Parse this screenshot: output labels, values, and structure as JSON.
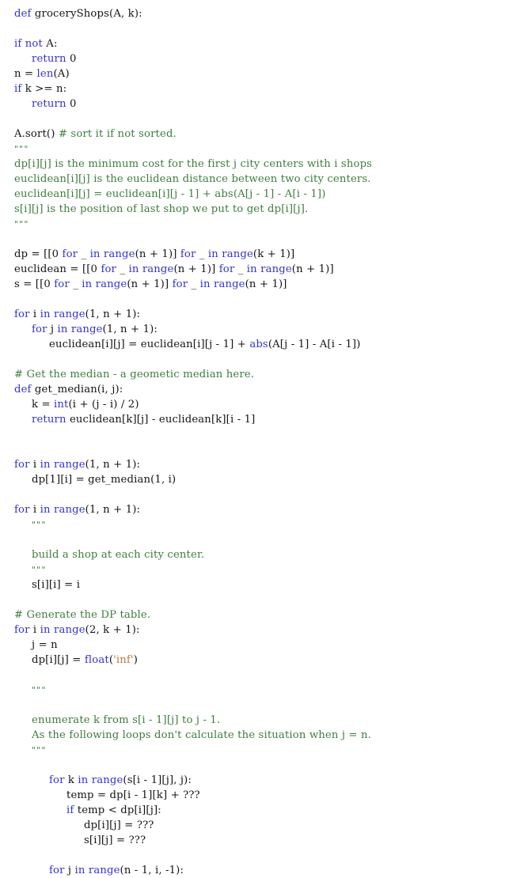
{
  "document": {
    "kind": "source-code-listing",
    "language": "Python",
    "function_name": "groceryShops",
    "background_color": "#ffffff",
    "colors": {
      "keyword": "#3434d4",
      "comment": "#3f7d3f",
      "string": "#bd7a3b",
      "plain": "#141414"
    }
  },
  "code_lines": [
    {
      "indent": 0,
      "tokens": [
        {
          "t": "def",
          "c": "kw"
        },
        {
          "t": " groceryShops(A, k):",
          "c": "pl"
        }
      ]
    },
    {
      "indent": 0,
      "tokens": []
    },
    {
      "indent": 0,
      "tokens": [
        {
          "t": "if not",
          "c": "kw"
        },
        {
          "t": " A:",
          "c": "pl"
        }
      ]
    },
    {
      "indent": 1,
      "tokens": [
        {
          "t": "return",
          "c": "kw"
        },
        {
          "t": " 0",
          "c": "pl"
        }
      ]
    },
    {
      "indent": 0,
      "tokens": [
        {
          "t": "n = ",
          "c": "pl"
        },
        {
          "t": "len",
          "c": "kw"
        },
        {
          "t": "(A)",
          "c": "pl"
        }
      ]
    },
    {
      "indent": 0,
      "tokens": [
        {
          "t": "if",
          "c": "kw"
        },
        {
          "t": " k >= n:",
          "c": "pl"
        }
      ]
    },
    {
      "indent": 1,
      "tokens": [
        {
          "t": "return",
          "c": "kw"
        },
        {
          "t": " 0",
          "c": "pl"
        }
      ]
    },
    {
      "indent": 0,
      "tokens": []
    },
    {
      "indent": 0,
      "tokens": [
        {
          "t": "A.sort() ",
          "c": "pl"
        },
        {
          "t": "# sort it if not sorted.",
          "c": "cm"
        }
      ]
    },
    {
      "indent": 0,
      "tokens": [
        {
          "t": "\"\"\"",
          "c": "tq"
        }
      ]
    },
    {
      "indent": 0,
      "tokens": [
        {
          "t": "dp[i][j] is the minimum cost for the first j city centers with i shops",
          "c": "cm"
        }
      ]
    },
    {
      "indent": 0,
      "tokens": [
        {
          "t": "euclidean[i][j] is the euclidean distance between two city centers.",
          "c": "cm"
        }
      ]
    },
    {
      "indent": 0,
      "tokens": [
        {
          "t": "euclidean[i][j] = euclidean[i][j - 1] + abs(A[j - 1] - A[i - 1])",
          "c": "cm"
        }
      ]
    },
    {
      "indent": 0,
      "tokens": [
        {
          "t": "s[i][j] is the position of last shop we put to get dp[i][j].",
          "c": "cm"
        }
      ]
    },
    {
      "indent": 0,
      "tokens": [
        {
          "t": "\"\"\"",
          "c": "tq"
        }
      ]
    },
    {
      "indent": 0,
      "tokens": []
    },
    {
      "indent": 0,
      "tokens": [
        {
          "t": "dp = [[0 ",
          "c": "pl"
        },
        {
          "t": "for",
          "c": "kw"
        },
        {
          "t": " _ ",
          "c": "pl"
        },
        {
          "t": "in",
          "c": "kw"
        },
        {
          "t": " ",
          "c": "pl"
        },
        {
          "t": "range",
          "c": "kw"
        },
        {
          "t": "(n + 1)] ",
          "c": "pl"
        },
        {
          "t": "for",
          "c": "kw"
        },
        {
          "t": " _ ",
          "c": "pl"
        },
        {
          "t": "in",
          "c": "kw"
        },
        {
          "t": " ",
          "c": "pl"
        },
        {
          "t": "range",
          "c": "kw"
        },
        {
          "t": "(k + 1)]",
          "c": "pl"
        }
      ]
    },
    {
      "indent": 0,
      "tokens": [
        {
          "t": "euclidean = [[0 ",
          "c": "pl"
        },
        {
          "t": "for",
          "c": "kw"
        },
        {
          "t": " _ ",
          "c": "pl"
        },
        {
          "t": "in",
          "c": "kw"
        },
        {
          "t": " ",
          "c": "pl"
        },
        {
          "t": "range",
          "c": "kw"
        },
        {
          "t": "(n + 1)] ",
          "c": "pl"
        },
        {
          "t": "for",
          "c": "kw"
        },
        {
          "t": " _ ",
          "c": "pl"
        },
        {
          "t": "in",
          "c": "kw"
        },
        {
          "t": " ",
          "c": "pl"
        },
        {
          "t": "range",
          "c": "kw"
        },
        {
          "t": "(n + 1)]",
          "c": "pl"
        }
      ]
    },
    {
      "indent": 0,
      "tokens": [
        {
          "t": "s = [[0 ",
          "c": "pl"
        },
        {
          "t": "for",
          "c": "kw"
        },
        {
          "t": " _ ",
          "c": "pl"
        },
        {
          "t": "in",
          "c": "kw"
        },
        {
          "t": " ",
          "c": "pl"
        },
        {
          "t": "range",
          "c": "kw"
        },
        {
          "t": "(n + 1)] ",
          "c": "pl"
        },
        {
          "t": "for",
          "c": "kw"
        },
        {
          "t": " _ ",
          "c": "pl"
        },
        {
          "t": "in",
          "c": "kw"
        },
        {
          "t": " ",
          "c": "pl"
        },
        {
          "t": "range",
          "c": "kw"
        },
        {
          "t": "(n + 1)]",
          "c": "pl"
        }
      ]
    },
    {
      "indent": 0,
      "tokens": []
    },
    {
      "indent": 0,
      "tokens": [
        {
          "t": "for",
          "c": "kw"
        },
        {
          "t": " i ",
          "c": "pl"
        },
        {
          "t": "in",
          "c": "kw"
        },
        {
          "t": " ",
          "c": "pl"
        },
        {
          "t": "range",
          "c": "kw"
        },
        {
          "t": "(1, n + 1):",
          "c": "pl"
        }
      ]
    },
    {
      "indent": 1,
      "tokens": [
        {
          "t": "for",
          "c": "kw"
        },
        {
          "t": " j ",
          "c": "pl"
        },
        {
          "t": "in",
          "c": "kw"
        },
        {
          "t": " ",
          "c": "pl"
        },
        {
          "t": "range",
          "c": "kw"
        },
        {
          "t": "(1, n + 1):",
          "c": "pl"
        }
      ]
    },
    {
      "indent": 2,
      "tokens": [
        {
          "t": "euclidean[i][j] = euclidean[i][j - 1] + ",
          "c": "pl"
        },
        {
          "t": "abs",
          "c": "kw"
        },
        {
          "t": "(A[j - 1] - A[i - 1])",
          "c": "pl"
        }
      ]
    },
    {
      "indent": 0,
      "tokens": []
    },
    {
      "indent": 0,
      "tokens": [
        {
          "t": "# Get the median - a geometic median here.",
          "c": "cm"
        }
      ]
    },
    {
      "indent": 0,
      "tokens": [
        {
          "t": "def",
          "c": "kw"
        },
        {
          "t": " get_median(i, j):",
          "c": "pl"
        }
      ]
    },
    {
      "indent": 1,
      "tokens": [
        {
          "t": "k = ",
          "c": "pl"
        },
        {
          "t": "int",
          "c": "kw"
        },
        {
          "t": "(i + (j - i) / 2)",
          "c": "pl"
        }
      ]
    },
    {
      "indent": 1,
      "tokens": [
        {
          "t": "return",
          "c": "kw"
        },
        {
          "t": " euclidean[k][j] - euclidean[k][i - 1]",
          "c": "pl"
        }
      ]
    },
    {
      "indent": 0,
      "tokens": []
    },
    {
      "indent": 0,
      "tokens": []
    },
    {
      "indent": 0,
      "tokens": [
        {
          "t": "for",
          "c": "kw"
        },
        {
          "t": " i ",
          "c": "pl"
        },
        {
          "t": "in",
          "c": "kw"
        },
        {
          "t": " ",
          "c": "pl"
        },
        {
          "t": "range",
          "c": "kw"
        },
        {
          "t": "(1, n + 1):",
          "c": "pl"
        }
      ]
    },
    {
      "indent": 1,
      "tokens": [
        {
          "t": "dp[1][i] = get_median(1, i)",
          "c": "pl"
        }
      ]
    },
    {
      "indent": 0,
      "tokens": []
    },
    {
      "indent": 0,
      "tokens": [
        {
          "t": "for",
          "c": "kw"
        },
        {
          "t": " i ",
          "c": "pl"
        },
        {
          "t": "in",
          "c": "kw"
        },
        {
          "t": " ",
          "c": "pl"
        },
        {
          "t": "range",
          "c": "kw"
        },
        {
          "t": "(1, n + 1):",
          "c": "pl"
        }
      ]
    },
    {
      "indent": 1,
      "tokens": [
        {
          "t": "\"\"\"",
          "c": "tq"
        }
      ]
    },
    {
      "indent": 1,
      "tokens": []
    },
    {
      "indent": 1,
      "tokens": [
        {
          "t": "build a shop at each city center.",
          "c": "cm"
        }
      ]
    },
    {
      "indent": 1,
      "tokens": [
        {
          "t": "\"\"\"",
          "c": "tq"
        }
      ]
    },
    {
      "indent": 1,
      "tokens": [
        {
          "t": "s[i][i] = i",
          "c": "pl"
        }
      ]
    },
    {
      "indent": 0,
      "tokens": []
    },
    {
      "indent": 0,
      "tokens": [
        {
          "t": "# Generate the DP table.",
          "c": "cm"
        }
      ]
    },
    {
      "indent": 0,
      "tokens": [
        {
          "t": "for",
          "c": "kw"
        },
        {
          "t": " i ",
          "c": "pl"
        },
        {
          "t": "in",
          "c": "kw"
        },
        {
          "t": " ",
          "c": "pl"
        },
        {
          "t": "range",
          "c": "kw"
        },
        {
          "t": "(2, k + 1):",
          "c": "pl"
        }
      ]
    },
    {
      "indent": 1,
      "tokens": [
        {
          "t": "j = n",
          "c": "pl"
        }
      ]
    },
    {
      "indent": 1,
      "tokens": [
        {
          "t": "dp[i][j] = ",
          "c": "pl"
        },
        {
          "t": "float",
          "c": "kw"
        },
        {
          "t": "(",
          "c": "pl"
        },
        {
          "t": "'inf'",
          "c": "str"
        },
        {
          "t": ")",
          "c": "pl"
        }
      ]
    },
    {
      "indent": 1,
      "tokens": []
    },
    {
      "indent": 1,
      "tokens": [
        {
          "t": "\"\"\"",
          "c": "tq"
        }
      ]
    },
    {
      "indent": 1,
      "tokens": []
    },
    {
      "indent": 1,
      "tokens": [
        {
          "t": "enumerate k from s[i - 1][j] to j - 1.",
          "c": "cm"
        }
      ]
    },
    {
      "indent": 1,
      "tokens": [
        {
          "t": "As the following loops don't calculate the situation when j = n.",
          "c": "cm"
        }
      ]
    },
    {
      "indent": 1,
      "tokens": [
        {
          "t": "\"\"\"",
          "c": "tq"
        }
      ]
    },
    {
      "indent": 1,
      "tokens": []
    },
    {
      "indent": 2,
      "tokens": [
        {
          "t": "for",
          "c": "kw"
        },
        {
          "t": " k ",
          "c": "pl"
        },
        {
          "t": "in",
          "c": "kw"
        },
        {
          "t": " ",
          "c": "pl"
        },
        {
          "t": "range",
          "c": "kw"
        },
        {
          "t": "(s[i - 1][j], j):",
          "c": "pl"
        }
      ]
    },
    {
      "indent": 3,
      "tokens": [
        {
          "t": "temp = dp[i - 1][k] + ???",
          "c": "pl"
        }
      ]
    },
    {
      "indent": 3,
      "tokens": [
        {
          "t": "if",
          "c": "kw"
        },
        {
          "t": " temp < dp[i][j]:",
          "c": "pl"
        }
      ]
    },
    {
      "indent": 4,
      "tokens": [
        {
          "t": "dp[i][j] = ???",
          "c": "pl"
        }
      ]
    },
    {
      "indent": 4,
      "tokens": [
        {
          "t": "s[i][j] = ???",
          "c": "pl"
        }
      ]
    },
    {
      "indent": 2,
      "tokens": []
    },
    {
      "indent": 2,
      "tokens": [
        {
          "t": "for",
          "c": "kw"
        },
        {
          "t": " j ",
          "c": "pl"
        },
        {
          "t": "in",
          "c": "kw"
        },
        {
          "t": " ",
          "c": "pl"
        },
        {
          "t": "range",
          "c": "kw"
        },
        {
          "t": "(n - 1, i, -1):",
          "c": "pl"
        }
      ]
    }
  ]
}
